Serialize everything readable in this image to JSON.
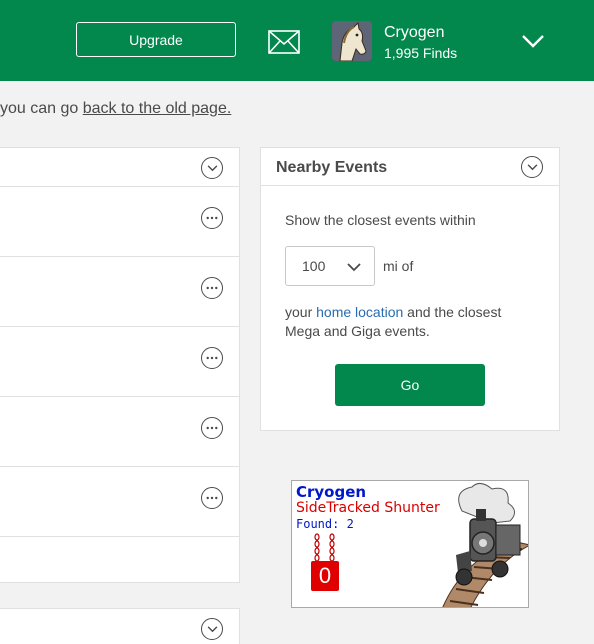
{
  "topbar": {
    "upgrade_label": "Upgrade",
    "user_name": "Cryogen",
    "user_finds": "1,995 Finds",
    "accent_color": "#02874d"
  },
  "notice": {
    "prefix": "you can go ",
    "link_text": "back to the old page."
  },
  "nearby_events": {
    "title": "Nearby Events",
    "description": "Show the closest events within",
    "distance_value": "100",
    "unit_text": "mi of",
    "home_prefix": "your ",
    "home_link": "home location",
    "home_suffix": " and the closest Mega and Giga events.",
    "go_label": "Go"
  },
  "badge": {
    "name": "Cryogen",
    "souvenir": "SideTracked Shunter",
    "found_text": "Found: 2",
    "counter": "0"
  },
  "icons": {
    "mail": "mail-icon",
    "user_menu": "chevron-down-icon",
    "more": "more-options-icon",
    "collapse": "chevron-down-circle-icon"
  }
}
